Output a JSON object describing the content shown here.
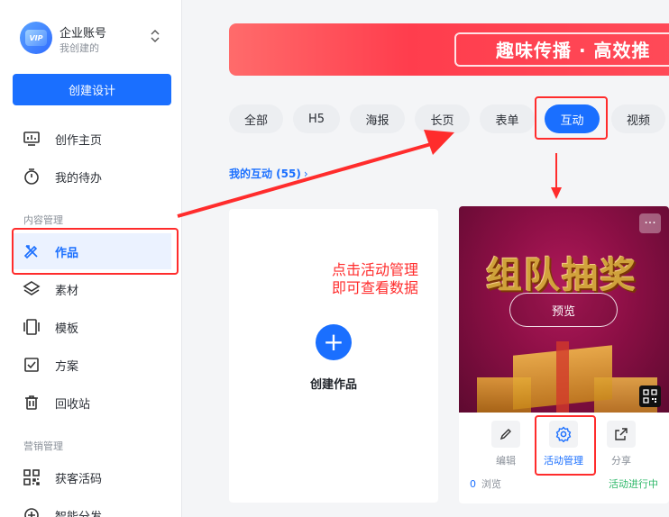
{
  "account": {
    "name": "企业账号",
    "sub": "我创建的",
    "avatar_text": "VIP"
  },
  "sidebar": {
    "create_label": "创建设计",
    "items": [
      {
        "label": "创作主页",
        "icon": "dashboard-icon"
      },
      {
        "label": "我的待办",
        "icon": "timer-icon"
      }
    ],
    "section_content": "内容管理",
    "content_items": [
      {
        "label": "作品",
        "icon": "pencil-ruler-icon",
        "active": true
      },
      {
        "label": "素材",
        "icon": "layers-icon"
      },
      {
        "label": "模板",
        "icon": "template-icon"
      },
      {
        "label": "方案",
        "icon": "checklist-icon"
      },
      {
        "label": "回收站",
        "icon": "trash-icon"
      }
    ],
    "section_marketing": "营销管理",
    "marketing_items": [
      {
        "label": "获客活码",
        "icon": "qrcode-icon"
      },
      {
        "label": "智能分发",
        "icon": "distribute-icon"
      }
    ]
  },
  "banner": {
    "text": "趣味传播 · 高效推"
  },
  "tabs": [
    "全部",
    "H5",
    "海报",
    "长页",
    "表单",
    "互动",
    "视频"
  ],
  "active_tab": "互动",
  "section": {
    "title": "我的互动 (55)",
    "chevron": "›"
  },
  "new_card": {
    "plus": "+",
    "label": "创建作品"
  },
  "annotation": {
    "text": "点击活动管理\n即可查看数据"
  },
  "work_card": {
    "cover_title": "组队抽奖",
    "more": "···",
    "preview_label": "预览",
    "actions": [
      {
        "label": "编辑",
        "icon": "edit-icon"
      },
      {
        "label": "活动管理",
        "icon": "settings-icon"
      },
      {
        "label": "分享",
        "icon": "share-icon"
      }
    ],
    "views_count": "0",
    "views_label": "浏览",
    "status": "活动进行中"
  },
  "colors": {
    "accent": "#1a6fff",
    "annotation": "#ff2c2c",
    "status": "#2fb86a"
  }
}
